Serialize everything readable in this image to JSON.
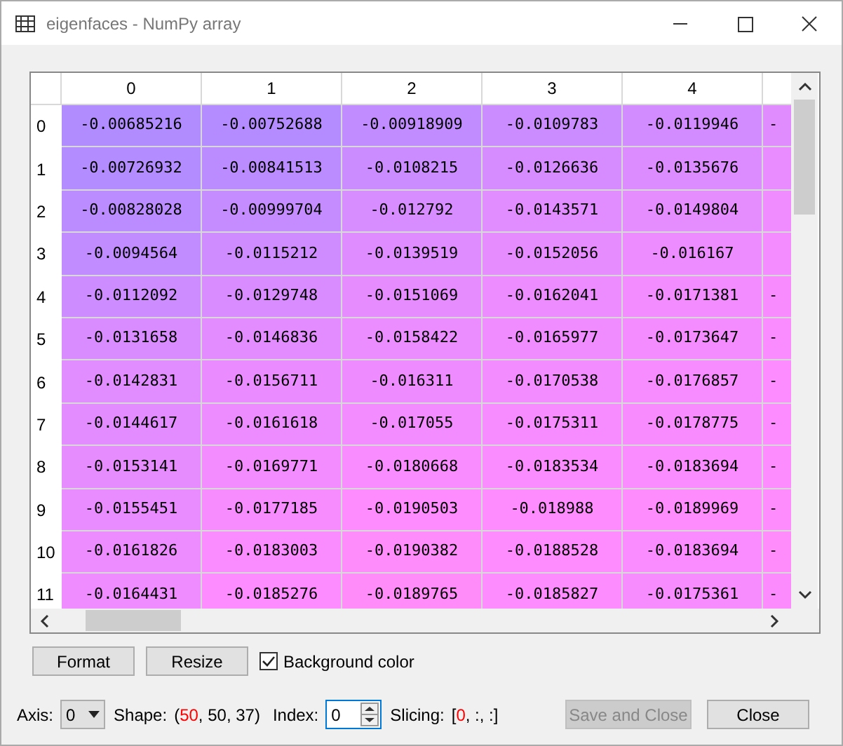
{
  "window": {
    "title": "eigenfaces - NumPy array"
  },
  "table": {
    "columns": [
      "0",
      "1",
      "2",
      "3",
      "4"
    ],
    "rows": [
      {
        "label": "0",
        "cells": [
          {
            "text": "-0.00685216",
            "color": "#b08cff"
          },
          {
            "text": "-0.00752688",
            "color": "#b58cff"
          },
          {
            "text": "-0.00918909",
            "color": "#c08cff"
          },
          {
            "text": "-0.0109783",
            "color": "#cb8cff"
          },
          {
            "text": "-0.0119946",
            "color": "#d28cff"
          },
          {
            "text": "-",
            "color": "#e08cff"
          }
        ]
      },
      {
        "label": "1",
        "cells": [
          {
            "text": "-0.00726932",
            "color": "#b38cff"
          },
          {
            "text": "-0.00841513",
            "color": "#bb8cff"
          },
          {
            "text": "-0.0108215",
            "color": "#ca8cff"
          },
          {
            "text": "-0.0126636",
            "color": "#d68cff"
          },
          {
            "text": "-0.0135676",
            "color": "#dc8cff"
          },
          {
            "color": "#e88cff"
          }
        ]
      },
      {
        "label": "2",
        "cells": [
          {
            "text": "-0.00828028",
            "color": "#ba8cff"
          },
          {
            "text": "-0.00999704",
            "color": "#c58cff"
          },
          {
            "text": "-0.012792",
            "color": "#d78cff"
          },
          {
            "text": "-0.0143571",
            "color": "#e18cff"
          },
          {
            "text": "-0.0149804",
            "color": "#e58cff"
          },
          {
            "color": "#f08cff"
          }
        ]
      },
      {
        "label": "3",
        "cells": [
          {
            "text": "-0.0094564",
            "color": "#c18cff"
          },
          {
            "text": "-0.0115212",
            "color": "#cf8cff"
          },
          {
            "text": "-0.0139519",
            "color": "#de8cff"
          },
          {
            "text": "-0.0152056",
            "color": "#e78cff"
          },
          {
            "text": "-0.016167",
            "color": "#ed8cff"
          },
          {
            "color": "#f48cff"
          }
        ]
      },
      {
        "label": "4",
        "cells": [
          {
            "text": "-0.0112092",
            "color": "#cd8cff"
          },
          {
            "text": "-0.0129748",
            "color": "#d88cff"
          },
          {
            "text": "-0.0151069",
            "color": "#e68cff"
          },
          {
            "text": "-0.0162041",
            "color": "#ed8cff"
          },
          {
            "text": "-0.0171381",
            "color": "#f38cff"
          },
          {
            "text": "-",
            "color": "#f88cff"
          }
        ]
      },
      {
        "label": "5",
        "cells": [
          {
            "text": "-0.0131658",
            "color": "#d98cff"
          },
          {
            "text": "-0.0146836",
            "color": "#e38cff"
          },
          {
            "text": "-0.0158422",
            "color": "#eb8cff"
          },
          {
            "text": "-0.0165977",
            "color": "#f08cff"
          },
          {
            "text": "-0.0173647",
            "color": "#f48cff"
          },
          {
            "text": "-",
            "color": "#fa8cff"
          }
        ]
      },
      {
        "label": "6",
        "cells": [
          {
            "text": "-0.0142831",
            "color": "#e18cff"
          },
          {
            "text": "-0.0156711",
            "color": "#ea8cff"
          },
          {
            "text": "-0.016311",
            "color": "#ee8cff"
          },
          {
            "text": "-0.0170538",
            "color": "#f28cff"
          },
          {
            "text": "-0.0176857",
            "color": "#f68cff"
          },
          {
            "text": "-",
            "color": "#fc8cff"
          }
        ]
      },
      {
        "label": "7",
        "cells": [
          {
            "text": "-0.0144617",
            "color": "#e28cff"
          },
          {
            "text": "-0.0161618",
            "color": "#ed8cff"
          },
          {
            "text": "-0.017055",
            "color": "#f38cff"
          },
          {
            "text": "-0.0175311",
            "color": "#f68cff"
          },
          {
            "text": "-0.0178775",
            "color": "#f88cff"
          },
          {
            "text": "-",
            "color": "#fc8cff"
          }
        ]
      },
      {
        "label": "8",
        "cells": [
          {
            "text": "-0.0153141",
            "color": "#e78cff"
          },
          {
            "text": "-0.0169771",
            "color": "#f28cff"
          },
          {
            "text": "-0.0180668",
            "color": "#f98cff"
          },
          {
            "text": "-0.0183534",
            "color": "#fb8cff"
          },
          {
            "text": "-0.0183694",
            "color": "#fb8cff"
          },
          {
            "text": "-",
            "color": "#fd8cff"
          }
        ]
      },
      {
        "label": "9",
        "cells": [
          {
            "text": "-0.0155451",
            "color": "#e98cff"
          },
          {
            "text": "-0.0177185",
            "color": "#f78cff"
          },
          {
            "text": "-0.0190503",
            "color": "#ff8cff"
          },
          {
            "text": "-0.018988",
            "color": "#ff8cfe"
          },
          {
            "text": "-0.0189969",
            "color": "#ff8cfd"
          },
          {
            "text": "-",
            "color": "#ff8cfc"
          }
        ]
      },
      {
        "label": "10",
        "cells": [
          {
            "text": "-0.0161826",
            "color": "#ed8cff"
          },
          {
            "text": "-0.0183003",
            "color": "#fb8cff"
          },
          {
            "text": "-0.0190382",
            "color": "#ff8cfb"
          },
          {
            "text": "-0.0188528",
            "color": "#fe8cff"
          },
          {
            "text": "-0.0183694",
            "color": "#fa8cff"
          },
          {
            "text": "-",
            "color": "#ff8cfa"
          }
        ]
      },
      {
        "label": "11",
        "cells": [
          {
            "text": "-0.0164431",
            "color": "#ef8cff"
          },
          {
            "text": "-0.0185276",
            "color": "#fc8cff"
          },
          {
            "text": "-0.0189765",
            "color": "#ff8cf9"
          },
          {
            "text": "-0.0185827",
            "color": "#fd8cfe"
          },
          {
            "text": "-0.0175361",
            "color": "#f68cfe"
          },
          {
            "text": "-",
            "color": "#fc8cfd"
          }
        ]
      }
    ]
  },
  "buttons": [
    {
      "label": "Format"
    },
    {
      "label": "Resize"
    }
  ],
  "background_color": {
    "label": "Background color",
    "checked": true
  },
  "axis": {
    "label": "Axis:",
    "value": "0"
  },
  "shape": {
    "label": "Shape:",
    "parts": [
      {
        "text": "(",
        "highlighted": false
      },
      {
        "text": "50",
        "highlighted": true
      },
      {
        "text": ", 50, 37)",
        "highlighted": false
      }
    ]
  },
  "index": {
    "label": "Index:",
    "value": "0"
  },
  "slicing": {
    "label": "Slicing:",
    "parts": [
      {
        "text": "[",
        "highlighted": false
      },
      {
        "text": "0",
        "highlighted": true
      },
      {
        "text": ", :, :]",
        "highlighted": false
      }
    ]
  },
  "actions": [
    {
      "label": "Save and Close",
      "disabled": true
    },
    {
      "label": "Close",
      "disabled": false
    }
  ]
}
